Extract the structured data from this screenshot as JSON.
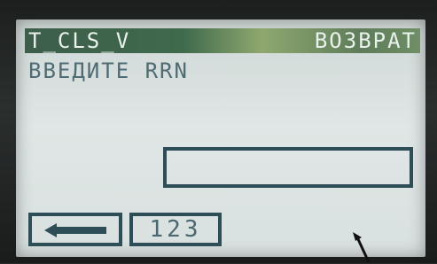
{
  "header": {
    "mode_code": "T_CLS_V",
    "operation": "ВОЗВРАТ"
  },
  "main": {
    "prompt": "ВВЕДИТЕ RRN",
    "rrn_value": ""
  },
  "softkeys": {
    "back_icon": "left-arrow-icon",
    "input_mode_label": "123"
  },
  "colors": {
    "lcd_background": "#dfe6e5",
    "titlebar": "#3f6a4c",
    "ink": "#2d4e56"
  }
}
